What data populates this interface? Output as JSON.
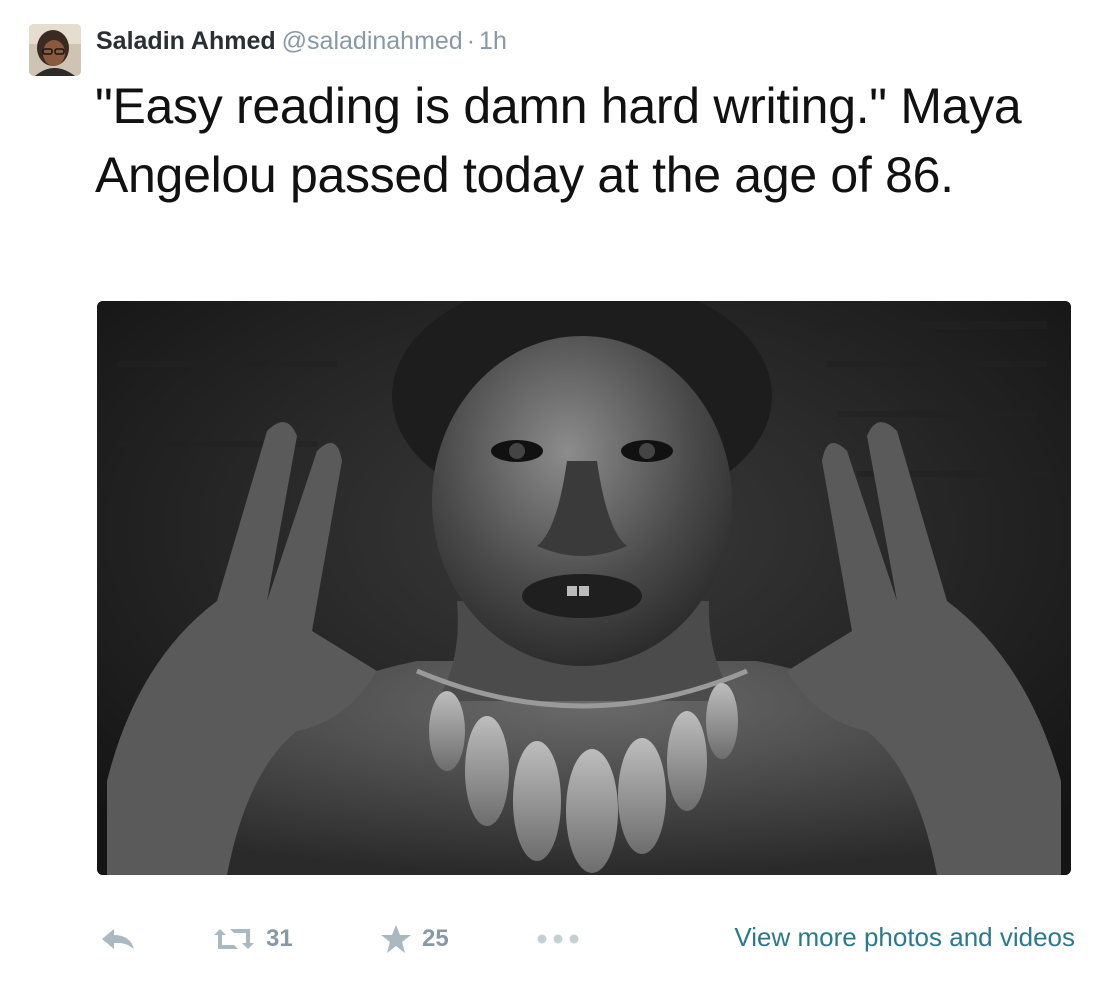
{
  "tweet": {
    "author_name": "Saladin Ahmed",
    "author_handle": "@saladinahmed",
    "separator": "·",
    "timestamp": "1h",
    "text": "\"Easy reading is damn hard writing.\" Maya Angelou passed today at the age of 86.",
    "retweet_count": "31",
    "favorite_count": "25",
    "view_more_link": "View more photos and videos"
  },
  "icons": {
    "reply": "reply-icon",
    "retweet": "retweet-icon",
    "favorite": "star-icon",
    "more": "ellipsis-icon"
  },
  "colors": {
    "name": "#292f33",
    "muted": "#8899a6",
    "icon": "#aab8c2",
    "link": "#2a7a8c",
    "text": "#111111"
  }
}
